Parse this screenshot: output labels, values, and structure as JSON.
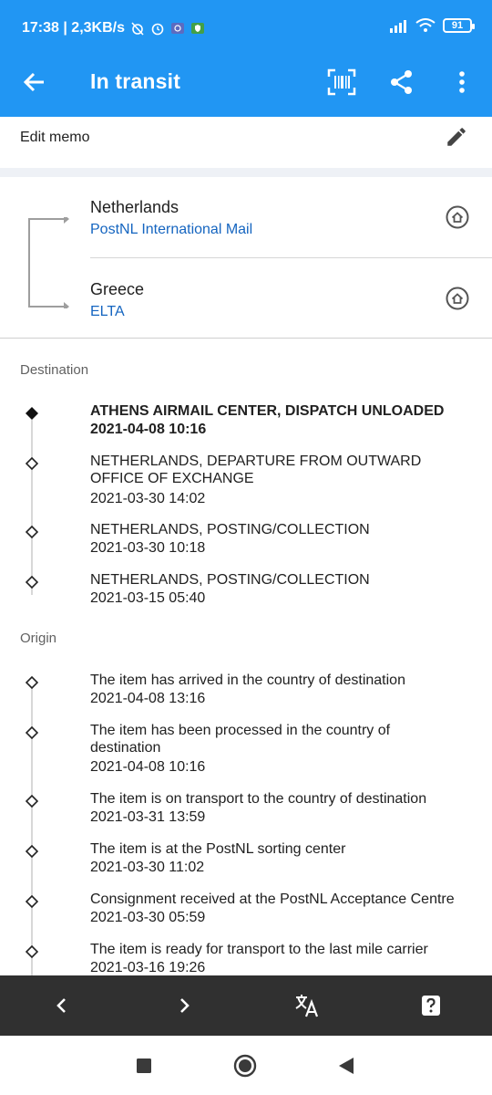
{
  "status_bar": {
    "time_net": "17:38 | 2,3KB/s",
    "battery": "91"
  },
  "app_bar": {
    "title": "In transit"
  },
  "memo": {
    "label": "Edit memo"
  },
  "route": {
    "from": {
      "country": "Netherlands",
      "carrier": "PostNL International Mail"
    },
    "to": {
      "country": "Greece",
      "carrier": "ELTA"
    }
  },
  "destination": {
    "header": "Destination",
    "events": [
      {
        "desc": "ATHENS AIRMAIL CENTER, DISPATCH UNLOADED",
        "date": "2021-04-08 10:16"
      },
      {
        "desc": "NETHERLANDS, DEPARTURE FROM OUTWARD OFFICE OF EXCHANGE",
        "date": "2021-03-30 14:02"
      },
      {
        "desc": "NETHERLANDS, POSTING/COLLECTION",
        "date": "2021-03-30 10:18"
      },
      {
        "desc": "NETHERLANDS, POSTING/COLLECTION",
        "date": "2021-03-15 05:40"
      }
    ]
  },
  "origin": {
    "header": "Origin",
    "events": [
      {
        "desc": "The item has arrived in the country of destination",
        "date": "2021-04-08 13:16"
      },
      {
        "desc": "The item has been processed in the country of destination",
        "date": "2021-04-08 10:16"
      },
      {
        "desc": "The item is on transport to the country of destination",
        "date": "2021-03-31 13:59"
      },
      {
        "desc": "The item is at the PostNL sorting center",
        "date": "2021-03-30 11:02"
      },
      {
        "desc": "Consignment received at the PostNL Acceptance Centre",
        "date": "2021-03-30 05:59"
      },
      {
        "desc": "The item is ready for transport to the last mile carrier",
        "date": "2021-03-16 19:26"
      }
    ]
  },
  "colors": {
    "primary": "#2196f3",
    "link": "#1565c0",
    "toolbar": "#303030"
  },
  "icons": {
    "back": "arrow-left-icon",
    "barcode": "barcode-scan-icon",
    "share": "share-icon",
    "more": "more-vert-icon",
    "edit": "pencil-icon",
    "home": "home-circle-icon",
    "prev": "chevron-left-icon",
    "next": "chevron-right-icon",
    "translate": "translate-icon",
    "help": "help-icon",
    "nav_recent": "square-icon",
    "nav_home": "circle-icon",
    "nav_back": "triangle-back-icon"
  }
}
